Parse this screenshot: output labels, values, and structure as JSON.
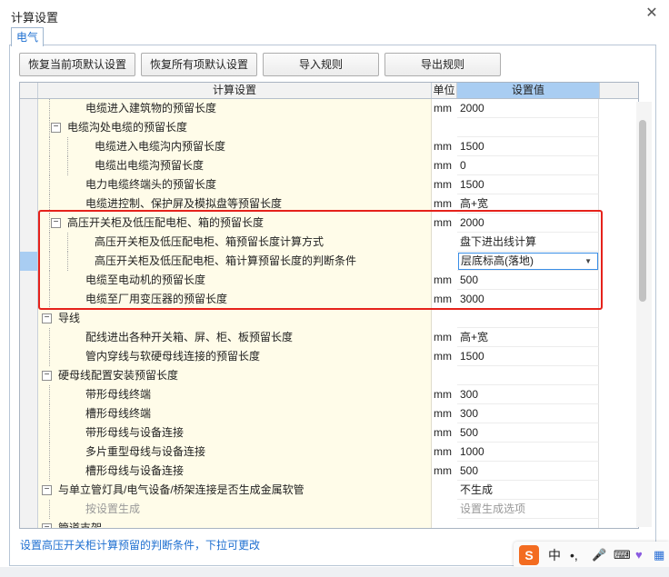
{
  "window": {
    "title": "计算设置"
  },
  "tabs": [
    {
      "label": "电气"
    }
  ],
  "toolbar": {
    "restore_current": "恢复当前项默认设置",
    "restore_all": "恢复所有项默认设置",
    "import_rules": "导入规则",
    "export_rules": "导出规则"
  },
  "table": {
    "columns": {
      "name": "计算设置",
      "unit": "单位",
      "value": "设置值"
    },
    "rows": [
      {
        "label": "电缆进入建筑物的预留长度",
        "unit": "mm",
        "value": "2000",
        "level": 1
      },
      {
        "label": "电缆沟处电缆的预留长度",
        "unit": "",
        "value": "",
        "level": 1,
        "toggle": "−",
        "flag": true
      },
      {
        "label": "电缆进入电缆沟内预留长度",
        "unit": "mm",
        "value": "1500",
        "level": 2
      },
      {
        "label": "电缆出电缆沟预留长度",
        "unit": "mm",
        "value": "0",
        "level": 2
      },
      {
        "label": "电力电缆终端头的预留长度",
        "unit": "mm",
        "value": "1500",
        "level": 1
      },
      {
        "label": "电缆进控制、保护屏及模拟盘等预留长度",
        "unit": "mm",
        "value": "高+宽",
        "level": 1
      },
      {
        "label": "高压开关柜及低压配电柜、箱的预留长度",
        "unit": "mm",
        "value": "2000",
        "level": 1,
        "toggle": "−",
        "flag": true
      },
      {
        "label": "高压开关柜及低压配电柜、箱预留长度计算方式",
        "unit": "",
        "value": "盘下进出线计算",
        "level": 2
      },
      {
        "label": "高压开关柜及低压配电柜、箱计算预留长度的判断条件",
        "unit": "",
        "value": "层底标高(落地)",
        "level": 2,
        "selected": true,
        "dropdown": true
      },
      {
        "label": "电缆至电动机的预留长度",
        "unit": "mm",
        "value": "500",
        "level": 1
      },
      {
        "label": "电缆至厂用变压器的预留长度",
        "unit": "mm",
        "value": "3000",
        "level": 1
      },
      {
        "label": "导线",
        "unit": "",
        "value": "",
        "level": 0,
        "toggle": "−"
      },
      {
        "label": "配线进出各种开关箱、屏、柜、板预留长度",
        "unit": "mm",
        "value": "高+宽",
        "level": 1
      },
      {
        "label": "管内穿线与软硬母线连接的预留长度",
        "unit": "mm",
        "value": "1500",
        "level": 1
      },
      {
        "label": "硬母线配置安装预留长度",
        "unit": "",
        "value": "",
        "level": 0,
        "toggle": "−"
      },
      {
        "label": "带形母线终端",
        "unit": "mm",
        "value": "300",
        "level": 1
      },
      {
        "label": "槽形母线终端",
        "unit": "mm",
        "value": "300",
        "level": 1
      },
      {
        "label": "带形母线与设备连接",
        "unit": "mm",
        "value": "500",
        "level": 1
      },
      {
        "label": "多片重型母线与设备连接",
        "unit": "mm",
        "value": "1000",
        "level": 1
      },
      {
        "label": "槽形母线与设备连接",
        "unit": "mm",
        "value": "500",
        "level": 1
      },
      {
        "label": "与单立管灯具/电气设备/桥架连接是否生成金属软管",
        "unit": "",
        "value": "不生成",
        "level": 0,
        "toggle": "−",
        "flag": true
      },
      {
        "label": "按设置生成",
        "unit": "",
        "value": "设置生成选项",
        "level": 1,
        "disabled": true
      },
      {
        "label": "管道支架",
        "unit": "",
        "value": "",
        "level": 0,
        "toggle": "−"
      }
    ]
  },
  "status": {
    "hint": "设置高压开关柜计算预留的判断条件，下拉可更改"
  },
  "ime": {
    "lang": "中",
    "punct": "•,"
  }
}
